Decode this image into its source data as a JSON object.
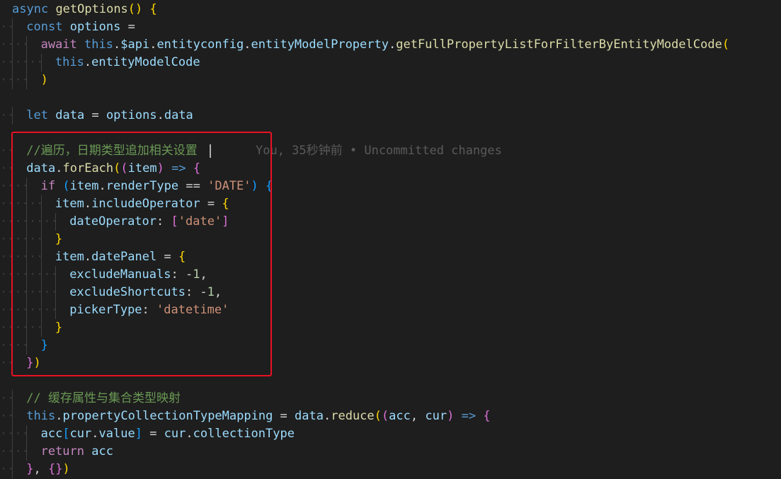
{
  "editor": {
    "theme_colors": {
      "background": "#1e1e1e",
      "keyword": "#569cd6",
      "control": "#c586c0",
      "function": "#dcdcaa",
      "variable": "#9cdcfe",
      "string": "#ce9178",
      "number": "#b5cea8",
      "comment": "#6a9955",
      "highlight_box": "#e81123"
    },
    "lines": [
      {
        "tokens": [
          [
            "kw",
            "async"
          ],
          [
            "op",
            " "
          ],
          [
            "fn",
            "getOptions"
          ],
          [
            "b1",
            "()"
          ],
          [
            "op",
            " "
          ],
          [
            "b1",
            "{"
          ]
        ]
      },
      {
        "tokens": [
          [
            "kw",
            "const"
          ],
          [
            "op",
            " "
          ],
          [
            "var",
            "options"
          ],
          [
            "op",
            " ="
          ]
        ]
      },
      {
        "tokens": [
          [
            "ctl",
            "await"
          ],
          [
            "op",
            " "
          ],
          [
            "kw",
            "this"
          ],
          [
            "op",
            "."
          ],
          [
            "var",
            "$api"
          ],
          [
            "op",
            "."
          ],
          [
            "var",
            "entityconfig"
          ],
          [
            "op",
            "."
          ],
          [
            "var",
            "entityModelProperty"
          ],
          [
            "op",
            "."
          ],
          [
            "fn",
            "getFullPropertyListForFilterByEntityModelCode"
          ],
          [
            "b1",
            "("
          ]
        ]
      },
      {
        "tokens": [
          [
            "kw",
            "this"
          ],
          [
            "op",
            "."
          ],
          [
            "var",
            "entityModelCode"
          ]
        ]
      },
      {
        "tokens": [
          [
            "b1",
            ")"
          ]
        ]
      },
      {
        "tokens": []
      },
      {
        "tokens": [
          [
            "kw",
            "let"
          ],
          [
            "op",
            " "
          ],
          [
            "var",
            "data"
          ],
          [
            "op",
            " = "
          ],
          [
            "var",
            "options"
          ],
          [
            "op",
            "."
          ],
          [
            "var",
            "data"
          ]
        ]
      },
      {
        "tokens": []
      },
      {
        "tokens": [
          [
            "cmt",
            "//遍历，日期类型追加相关设置"
          ]
        ],
        "blame": "You, 35秒钟前 • Uncommitted changes"
      },
      {
        "tokens": [
          [
            "var",
            "data"
          ],
          [
            "op",
            "."
          ],
          [
            "fn",
            "forEach"
          ],
          [
            "b1",
            "("
          ],
          [
            "b2",
            "("
          ],
          [
            "var",
            "item"
          ],
          [
            "b2",
            ")"
          ],
          [
            "op",
            " "
          ],
          [
            "kw",
            "=>"
          ],
          [
            "op",
            " "
          ],
          [
            "b2",
            "{"
          ]
        ]
      },
      {
        "tokens": [
          [
            "ctl",
            "if"
          ],
          [
            "op",
            " "
          ],
          [
            "b3",
            "("
          ],
          [
            "var",
            "item"
          ],
          [
            "op",
            "."
          ],
          [
            "var",
            "renderType"
          ],
          [
            "op",
            " == "
          ],
          [
            "str",
            "'DATE'"
          ],
          [
            "b3",
            ")"
          ],
          [
            "op",
            " "
          ],
          [
            "b3",
            "{"
          ]
        ]
      },
      {
        "tokens": [
          [
            "var",
            "item"
          ],
          [
            "op",
            "."
          ],
          [
            "var",
            "includeOperator"
          ],
          [
            "op",
            " = "
          ],
          [
            "b1",
            "{"
          ]
        ]
      },
      {
        "tokens": [
          [
            "var",
            "dateOperator"
          ],
          [
            "op",
            ": "
          ],
          [
            "b2",
            "["
          ],
          [
            "str",
            "'date'"
          ],
          [
            "b2",
            "]"
          ]
        ]
      },
      {
        "tokens": [
          [
            "b1",
            "}"
          ]
        ]
      },
      {
        "tokens": [
          [
            "var",
            "item"
          ],
          [
            "op",
            "."
          ],
          [
            "var",
            "datePanel"
          ],
          [
            "op",
            " = "
          ],
          [
            "b1",
            "{"
          ]
        ]
      },
      {
        "tokens": [
          [
            "var",
            "excludeManuals"
          ],
          [
            "op",
            ": -"
          ],
          [
            "num",
            "1"
          ],
          [
            "op",
            ","
          ]
        ]
      },
      {
        "tokens": [
          [
            "var",
            "excludeShortcuts"
          ],
          [
            "op",
            ": -"
          ],
          [
            "num",
            "1"
          ],
          [
            "op",
            ","
          ]
        ]
      },
      {
        "tokens": [
          [
            "var",
            "pickerType"
          ],
          [
            "op",
            ": "
          ],
          [
            "str",
            "'datetime'"
          ]
        ]
      },
      {
        "tokens": [
          [
            "b1",
            "}"
          ]
        ]
      },
      {
        "tokens": [
          [
            "b3",
            "}"
          ]
        ]
      },
      {
        "tokens": [
          [
            "b2",
            "}"
          ],
          [
            "b1",
            ")"
          ]
        ]
      },
      {
        "tokens": []
      },
      {
        "tokens": [
          [
            "cmt",
            "// 缓存属性与集合类型映射"
          ]
        ]
      },
      {
        "tokens": [
          [
            "kw",
            "this"
          ],
          [
            "op",
            "."
          ],
          [
            "var",
            "propertyCollectionTypeMapping"
          ],
          [
            "op",
            " = "
          ],
          [
            "var",
            "data"
          ],
          [
            "op",
            "."
          ],
          [
            "fn",
            "reduce"
          ],
          [
            "b1",
            "("
          ],
          [
            "b2",
            "("
          ],
          [
            "var",
            "acc"
          ],
          [
            "op",
            ", "
          ],
          [
            "var",
            "cur"
          ],
          [
            "b2",
            ")"
          ],
          [
            "op",
            " "
          ],
          [
            "kw",
            "=>"
          ],
          [
            "op",
            " "
          ],
          [
            "b2",
            "{"
          ]
        ]
      },
      {
        "tokens": [
          [
            "var",
            "acc"
          ],
          [
            "b3",
            "["
          ],
          [
            "var",
            "cur"
          ],
          [
            "op",
            "."
          ],
          [
            "var",
            "value"
          ],
          [
            "b3",
            "]"
          ],
          [
            "op",
            " = "
          ],
          [
            "var",
            "cur"
          ],
          [
            "op",
            "."
          ],
          [
            "var",
            "collectionType"
          ]
        ]
      },
      {
        "tokens": [
          [
            "ctl",
            "return"
          ],
          [
            "op",
            " "
          ],
          [
            "var",
            "acc"
          ]
        ]
      },
      {
        "tokens": [
          [
            "b2",
            "}"
          ],
          [
            "op",
            ", "
          ],
          [
            "b2",
            "{}"
          ],
          [
            "b1",
            ")"
          ]
        ]
      }
    ]
  }
}
